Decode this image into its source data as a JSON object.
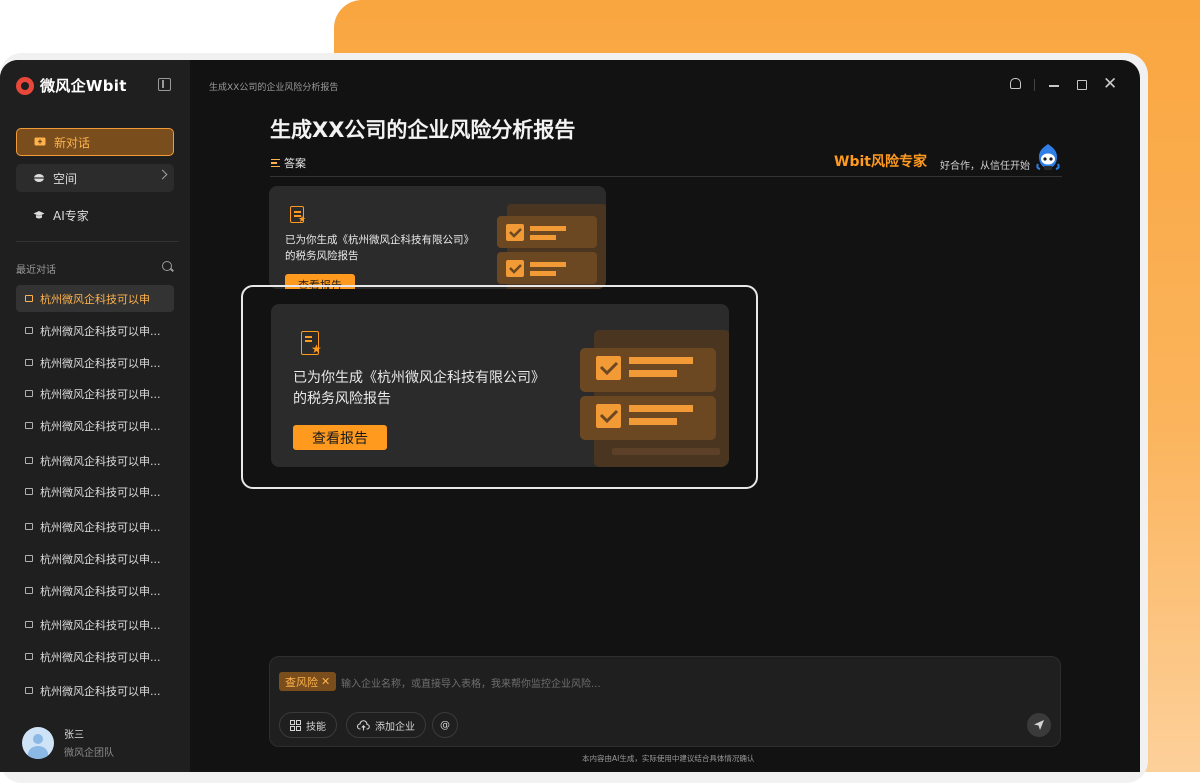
{
  "app": {
    "name": "微风企Wbit",
    "window_title": "生成XX公司的企业风险分析报告"
  },
  "sidebar": {
    "nav": [
      {
        "label": "新对话",
        "icon": "chat-plus-icon"
      },
      {
        "label": "空间",
        "icon": "space-icon"
      },
      {
        "label": "AI专家",
        "icon": "graduation-cap-icon"
      }
    ],
    "recent_label": "最近对话",
    "conversations": [
      "杭州微风企科技可以申",
      "杭州微风企科技可以申...",
      "杭州微风企科技可以申...",
      "杭州微风企科技可以申...",
      "杭州微风企科技可以申...",
      "杭州微风企科技可以申...",
      "杭州微风企科技可以申...",
      "杭州微风企科技可以申...",
      "杭州微风企科技可以申...",
      "杭州微风企科技可以申...",
      "杭州微风企科技可以申...",
      "杭州微风企科技可以申...",
      "杭州微风企科技可以申..."
    ],
    "user": {
      "name": "张三",
      "team": "微风企团队"
    }
  },
  "main": {
    "question": "生成XX公司的企业风险分析报告",
    "answer_label": "答案",
    "expert_name": "Wbit风险专家",
    "expert_slogan": "好合作，从信任开始",
    "report_card": {
      "text_line1": "已为你生成《杭州微风企科技有限公司》",
      "text_line2": "的税务风险报告",
      "button": "查看报告"
    }
  },
  "input": {
    "tag": "查风险",
    "placeholder": "输入企业名称，或直接导入表格，我来帮你监控企业风险...",
    "tools": [
      "技能",
      "添加企业",
      "@"
    ]
  },
  "footer_note": "本内容由AI生成，实际使用中建议结合具体情况确认",
  "colors": {
    "accent": "#ff9a1f",
    "background": "#121213",
    "sidebar": "#1f1f20"
  }
}
